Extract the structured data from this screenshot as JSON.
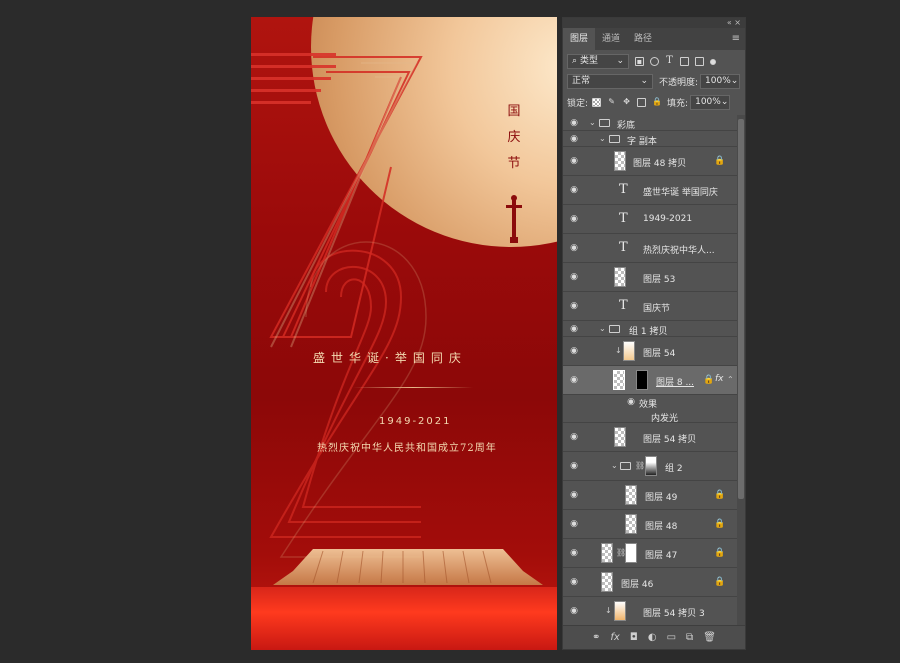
{
  "poster": {
    "vertical_title": "国\n庆\n节",
    "slogan": "盛世华诞·举国同庆",
    "years": "1949-2021",
    "subtitle": "热烈庆祝中华人民共和国成立72周年"
  },
  "panel": {
    "tabs": [
      "图层",
      "通道",
      "路径"
    ],
    "filter_kind": "类型",
    "blend_mode": "正常",
    "opacity_label": "不透明度:",
    "opacity_value": "100%",
    "lock_label": "锁定:",
    "fill_label": "填充:",
    "fill_value": "100%"
  },
  "layers": [
    {
      "name": "彩底",
      "kind": "group",
      "indent": 0
    },
    {
      "name": "字 副本",
      "kind": "group",
      "indent": 1
    },
    {
      "name": "图层 48 拷贝",
      "kind": "pixel",
      "indent": 2,
      "locked": true
    },
    {
      "name": "盛世华诞 举国同庆",
      "kind": "text",
      "indent": 2
    },
    {
      "name": "1949-2021",
      "kind": "text",
      "indent": 2
    },
    {
      "name": "热烈庆祝中华人...",
      "kind": "text",
      "indent": 2
    },
    {
      "name": "图层 53",
      "kind": "pixel",
      "indent": 2
    },
    {
      "name": "国庆节",
      "kind": "text",
      "indent": 2
    },
    {
      "name": "组 1 拷贝",
      "kind": "group",
      "indent": 1
    },
    {
      "name": "图层 54",
      "kind": "pixel",
      "indent": 2,
      "clipped": true
    },
    {
      "name": "图层 8 ...",
      "kind": "pixel-mask",
      "indent": 2,
      "locked": true,
      "fx": "fx",
      "selected": true
    },
    {
      "name": "效果",
      "kind": "effect",
      "indent": 3
    },
    {
      "name": "内发光",
      "kind": "effect-item",
      "indent": 4
    },
    {
      "name": "图层 54 拷贝",
      "kind": "pixel",
      "indent": 2
    },
    {
      "name": "组 2",
      "kind": "group-mask",
      "indent": 2
    },
    {
      "name": "图层 49",
      "kind": "pixel",
      "indent": 3,
      "locked": true
    },
    {
      "name": "图层 48",
      "kind": "pixel",
      "indent": 3,
      "locked": true
    },
    {
      "name": "图层 47",
      "kind": "pixel-mask",
      "indent": 1,
      "locked": true
    },
    {
      "name": "图层 46",
      "kind": "pixel",
      "indent": 1,
      "locked": true
    },
    {
      "name": "图层 54 拷贝 3",
      "kind": "pixel",
      "indent": 1,
      "clipped": true
    }
  ],
  "colors": {
    "accent_red": "#a30d0a",
    "gold": "#f3d9b0"
  }
}
